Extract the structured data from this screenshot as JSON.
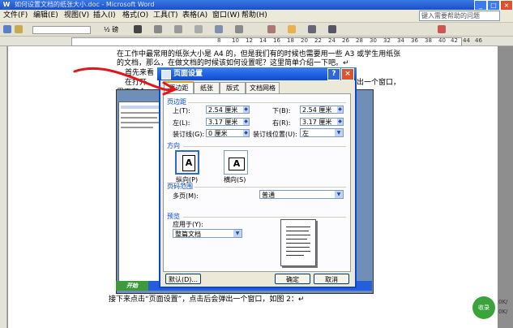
{
  "window": {
    "title": "如何设置文档的纸张大小.doc - Microsoft Word",
    "min": "_",
    "max": "□",
    "close": "×"
  },
  "menu": [
    "文件(F)",
    "编辑(E)",
    "视图(V)",
    "插入(I)",
    "格式(O)",
    "工具(T)",
    "表格(A)",
    "窗口(W)",
    "帮助(H)"
  ],
  "help_placeholder": "键入需要帮助的问题",
  "toolbar": {
    "font_size": "½ 磅",
    "ruler_numbers": [
      "8",
      "10",
      "12",
      "14",
      "16",
      "18",
      "20",
      "22",
      "24",
      "26",
      "28",
      "30",
      "32",
      "34",
      "36",
      "38",
      "40",
      "42",
      "44",
      "46"
    ]
  },
  "document": {
    "line1": "在工作中最常用的纸张大小是 A4 的，但是我们有的时候也需要用一些 A3 或学生用纸张",
    "line2": "的文档，那么，在做文档的时候该如何设置呢？这里简单介绍一下吧。↵",
    "line3": "首先来看",
    "line4": "在打开",
    "line4_tail": "出一个窗口，",
    "line5": "里面有个",
    "line_bottom": "接下来点击“页面设置”，点击后会弹出一个窗口，如图 2：↵"
  },
  "dialog": {
    "title": "页面设置",
    "help": "?",
    "close": "×",
    "tabs": [
      "页边距",
      "纸张",
      "版式",
      "文档网格"
    ],
    "margins_label": "页边距",
    "top_label": "上(T):",
    "top_value": "2.54 厘米",
    "bottom_label": "下(B):",
    "bottom_value": "2.54 厘米",
    "left_label": "左(L):",
    "left_value": "3.17 厘米",
    "right_label": "右(R):",
    "right_value": "3.17 厘米",
    "gutter_label": "装订线(G):",
    "gutter_value": "0 厘米",
    "gutter_pos_label": "装订线位置(U):",
    "gutter_pos_value": "左",
    "orientation_label": "方向",
    "portrait": "纵向(P)",
    "landscape": "横向(S)",
    "pages_label": "页码范围",
    "multi_pages_label": "多页(M):",
    "multi_pages_value": "普通",
    "preview_label": "预览",
    "apply_label": "应用于(Y):",
    "apply_value": "整篇文档",
    "default_button": "默认(D)...",
    "ok_button": "确定",
    "cancel_button": "取消"
  },
  "inner_start": "开始",
  "side": {
    "green": "收录",
    "t1": "0K/",
    "t2": "0K/"
  }
}
